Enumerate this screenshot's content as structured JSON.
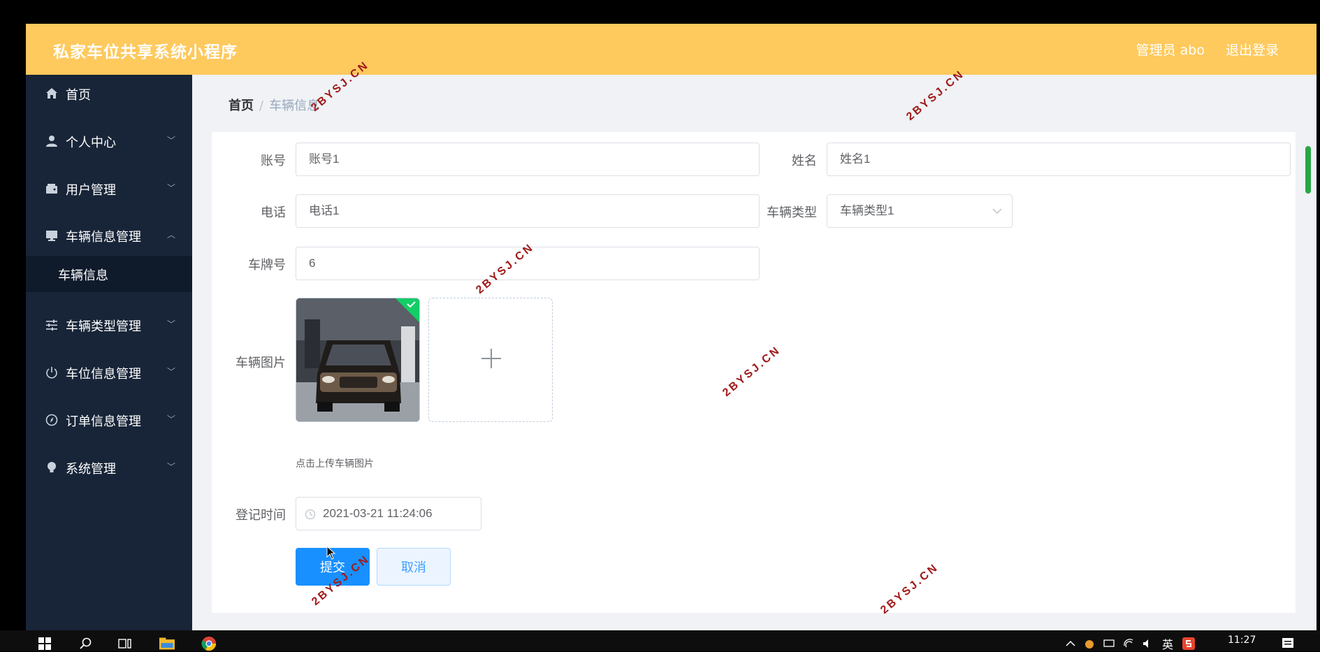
{
  "app": {
    "title": "私家车位共享系统小程序",
    "user": "管理员 abo",
    "logout": "退出登录"
  },
  "sidebar": {
    "items": [
      {
        "label": "首页",
        "icon": "home-icon"
      },
      {
        "label": "个人中心",
        "icon": "user-icon"
      },
      {
        "label": "用户管理",
        "icon": "wallet-icon"
      },
      {
        "label": "车辆信息管理",
        "icon": "monitor-icon",
        "expanded": true
      },
      {
        "label": "车辆类型管理",
        "icon": "sliders-icon"
      },
      {
        "label": "车位信息管理",
        "icon": "power-icon"
      },
      {
        "label": "订单信息管理",
        "icon": "compass-icon"
      },
      {
        "label": "系统管理",
        "icon": "bulb-icon"
      }
    ],
    "sub_item": "车辆信息"
  },
  "breadcrumb": {
    "home": "首页",
    "separator": "/",
    "current": "车辆信息"
  },
  "form": {
    "account_label": "账号",
    "account_value": "账号1",
    "name_label": "姓名",
    "name_value": "姓名1",
    "phone_label": "电话",
    "phone_value": "电话1",
    "vehicle_type_label": "车辆类型",
    "vehicle_type_value": "车辆类型1",
    "plate_label": "车牌号",
    "plate_value": "6",
    "image_label": "车辆图片",
    "upload_tip": "点击上传车辆图片",
    "register_time_label": "登记时间",
    "register_time_value": "2021-03-21 11:24:06",
    "submit": "提交",
    "cancel": "取消"
  },
  "watermark": "2BYSJ.CN",
  "taskbar": {
    "clock": "11:27",
    "ime": "英"
  },
  "colors": {
    "topbar": "#fec95d",
    "sidebar": "#182538",
    "primary": "#1890ff",
    "success": "#28a745"
  }
}
